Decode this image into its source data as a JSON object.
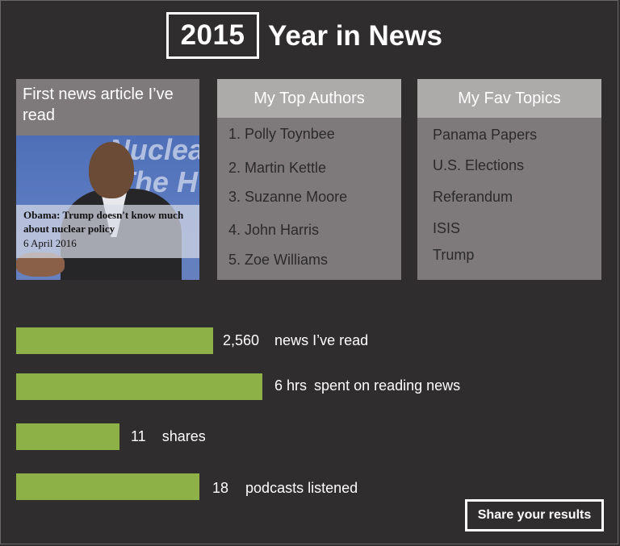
{
  "header": {
    "year": "2015",
    "title": "Year in News"
  },
  "first_article": {
    "title": "First news article I’ve read",
    "image_text": [
      "Nuclea",
      "The H"
    ],
    "headline": "Obama: Trump doesn't know much about nuclear policy",
    "date": "6 April 2016"
  },
  "authors": {
    "title": "My Top Authors",
    "items": [
      "1. Polly Toynbee",
      "2. Martin Kettle",
      "3. Suzanne Moore",
      "4. John Harris",
      "5. Zoe Williams"
    ]
  },
  "topics": {
    "title": "My Fav Topics",
    "items": [
      "Panama Papers",
      "U.S. Elections",
      "Referandum",
      "ISIS",
      "Trump"
    ]
  },
  "stats": [
    {
      "value": "2,560",
      "label": "news I’ve read"
    },
    {
      "value": "6 hrs",
      "label": "spent on reading news"
    },
    {
      "value": "11",
      "label": "shares"
    },
    {
      "value": "18",
      "label": "podcasts listened"
    }
  ],
  "share_label": "Share your results",
  "colors": {
    "background": "#2f2d2e",
    "card": "#7e7a7b",
    "card_header": "#adaaaa",
    "bar": "#8db047"
  }
}
